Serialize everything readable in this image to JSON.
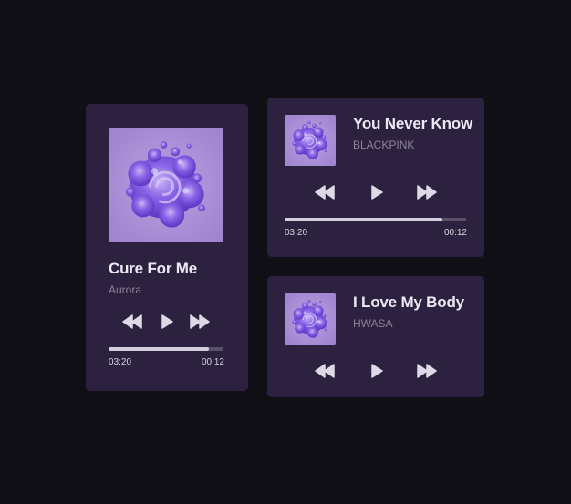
{
  "colors": {
    "background": "#110f16",
    "card": "#2c223f",
    "title": "#ece8f4",
    "artist": "#8d829f",
    "track": "#5b516d",
    "progress": "#d4cfdc",
    "cover": "#a78bd4"
  },
  "players": [
    {
      "title": "Cure For Me",
      "artist": "Aurora",
      "cover_icon": "purple-splash-album-art",
      "controls": [
        "rewind-icon",
        "play-icon",
        "fast-forward-icon"
      ],
      "progress": 0.87,
      "time_start": "03:20",
      "time_end": "00:12"
    },
    {
      "title": "You Never Know",
      "artist": "BLACKPINK",
      "cover_icon": "purple-splash-album-art",
      "controls": [
        "rewind-icon",
        "play-icon",
        "fast-forward-icon"
      ],
      "progress": 0.87,
      "time_start": "03:20",
      "time_end": "00:12"
    },
    {
      "title": "I Love My Body",
      "artist": "HWASA",
      "cover_icon": "purple-splash-album-art",
      "controls": [
        "rewind-icon",
        "play-icon",
        "fast-forward-icon"
      ]
    }
  ]
}
